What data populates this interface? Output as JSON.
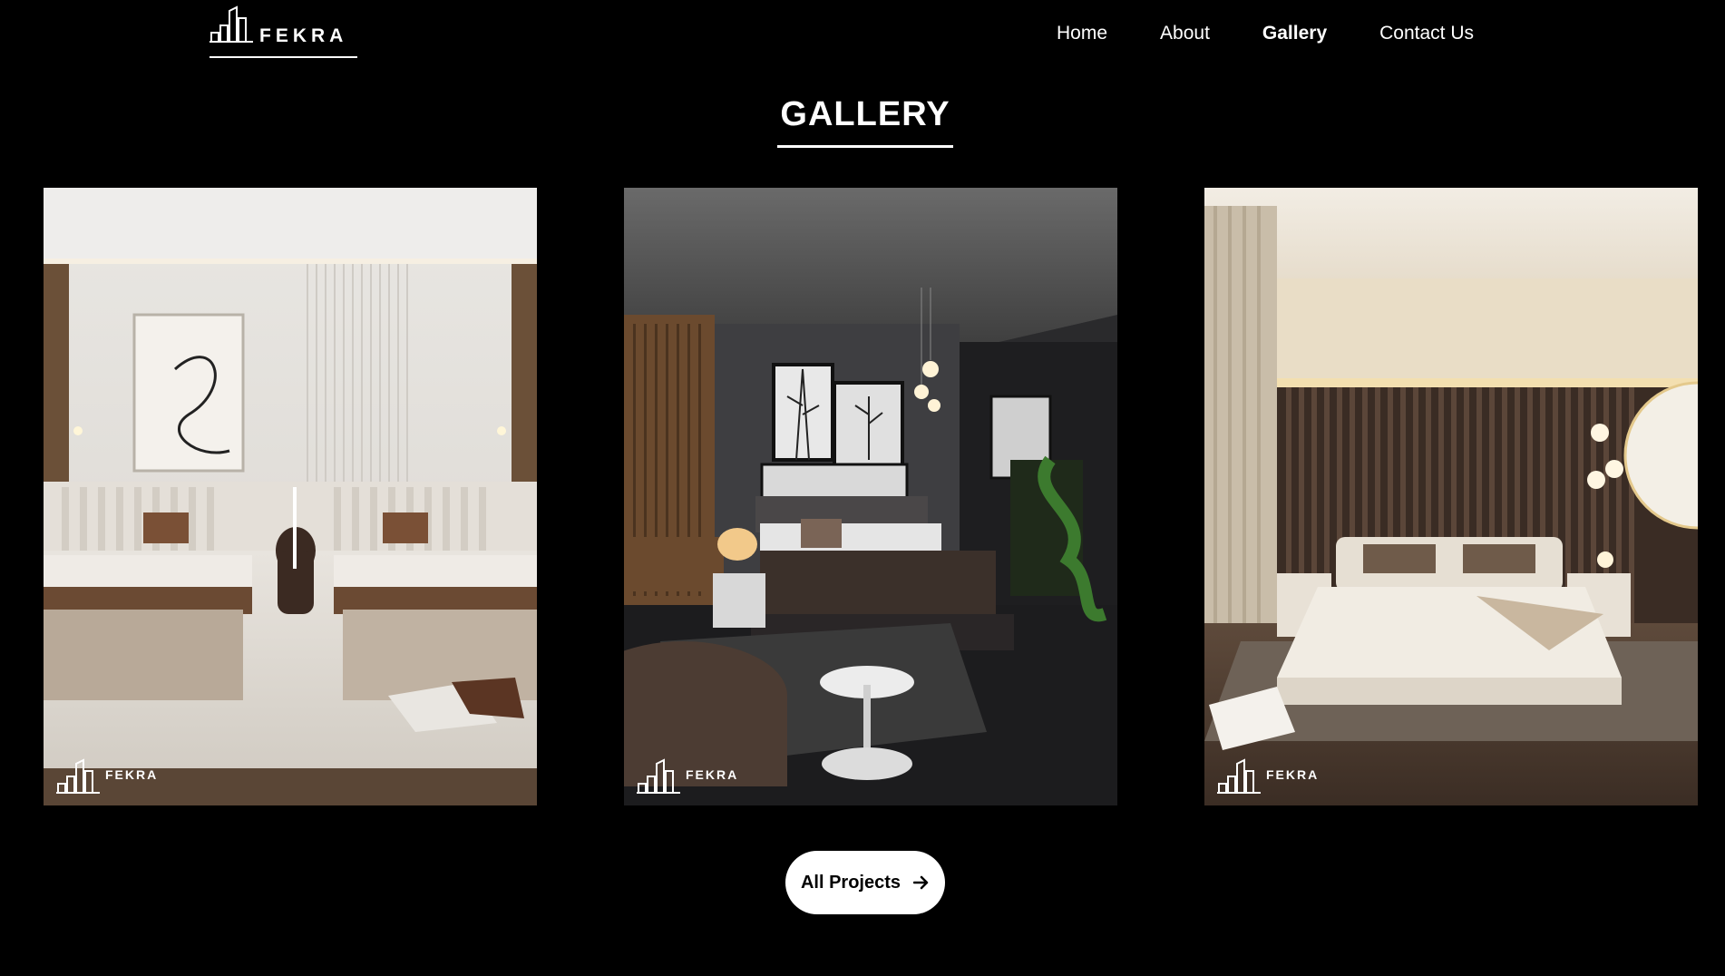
{
  "brand": {
    "name": "FEKRA"
  },
  "nav": {
    "items": [
      {
        "label": "Home",
        "active": false
      },
      {
        "label": "About",
        "active": false
      },
      {
        "label": "Gallery",
        "active": true
      },
      {
        "label": "Contact Us",
        "active": false
      }
    ]
  },
  "section": {
    "title": "GALLERY"
  },
  "gallery": {
    "items": [
      {
        "watermark": "FEKRA"
      },
      {
        "watermark": "FEKRA"
      },
      {
        "watermark": "FEKRA"
      }
    ]
  },
  "cta": {
    "label": "All Projects",
    "icon": "arrow-right-icon"
  }
}
